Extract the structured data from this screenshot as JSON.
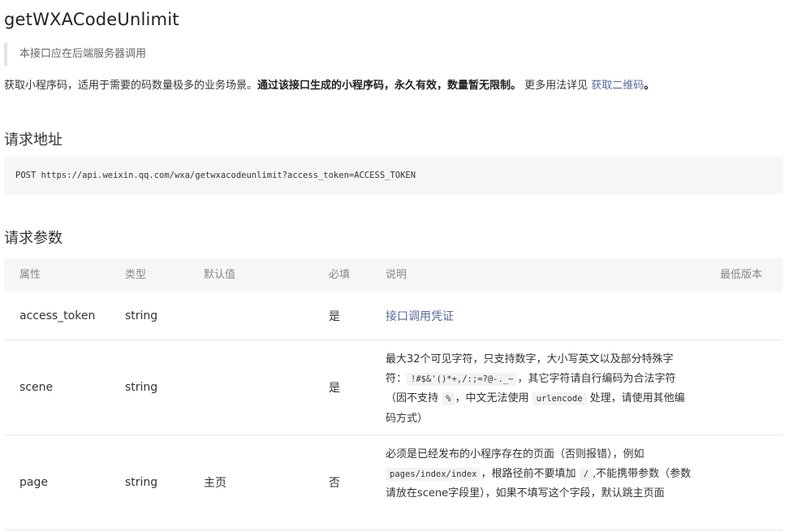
{
  "title": "getWXACodeUnlimit",
  "note": "本接口应在后端服务器调用",
  "description": {
    "text1": "获取小程序码，适用于需要的码数量极多的业务场景。",
    "bold": "通过该接口生成的小程序码，永久有效，数量暂无限制。",
    "text2": " 更多用法详见 ",
    "link": "获取二维码",
    "end": "。"
  },
  "section_request_url": "请求地址",
  "request_url": "POST https://api.weixin.qq.com/wxa/getwxacodeunlimit?access_token=ACCESS_TOKEN",
  "section_params": "请求参数",
  "table": {
    "headers": {
      "attr": "属性",
      "type": "类型",
      "default": "默认值",
      "required": "必填",
      "desc": "说明",
      "min_version": "最低版本"
    },
    "rows": [
      {
        "attr": "access_token",
        "type": "string",
        "default": "",
        "required": "是",
        "desc_link": "接口调用凭证"
      },
      {
        "attr": "scene",
        "type": "string",
        "default": "",
        "required": "是",
        "desc_p1": "最大32个可见字符，只支持数字，大小写英文以及部分特殊字符：",
        "desc_code1": "!#$&'()*+,/:;=?@-._~",
        "desc_p2": "，其它字符请自行编码为合法字符（因不支持",
        "desc_code2": "%",
        "desc_p3": "，中文无法使用",
        "desc_code3": "urlencode",
        "desc_p4": " 处理，请使用其他编码方式）"
      },
      {
        "attr": "page",
        "type": "string",
        "default": "主页",
        "required": "否",
        "desc_p1": "必须是已经发布的小程序存在的页面（否则报错），例如",
        "desc_code1": "pages/index/index",
        "desc_p2": "，根路径前不要填加",
        "desc_code2": "/",
        "desc_p3": ",不能携带参数（参数请放在scene字段里），如果不填写这个字段，默认跳主页面"
      }
    ]
  }
}
